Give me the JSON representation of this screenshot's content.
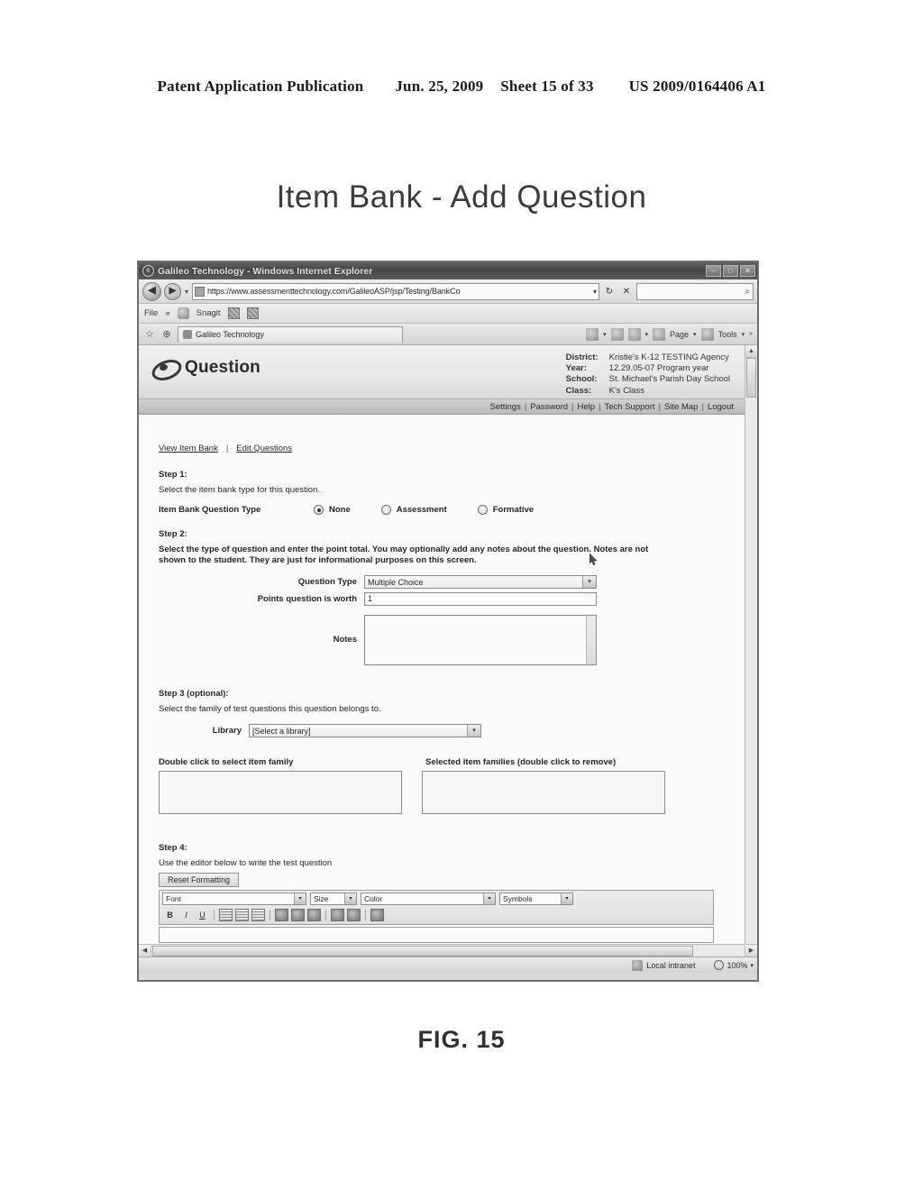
{
  "patent": {
    "publication": "Patent Application Publication",
    "date": "Jun. 25, 2009",
    "sheet": "Sheet 15 of 33",
    "number": "US 2009/0164406 A1",
    "figure_caption": "FIG. 15",
    "figure_title": "Item Bank - Add Question"
  },
  "browser": {
    "window_title": "Galileo Technology - Windows Internet Explorer",
    "window_icon": "e",
    "minimize_label": "–",
    "maximize_label": "□",
    "close_label": "✕",
    "back_label": "◀",
    "forward_label": "▶",
    "history_caret": "▾",
    "url": "https://www.assessmenttechnology.com/GalileoASP/jsp/Testing/BankCo",
    "url_dropdown": "▾",
    "refresh_label": "↻",
    "stop_label": "✕",
    "search_placeholder": "",
    "search_go": "⌕",
    "menu": {
      "file": "File",
      "more": "»"
    },
    "snagit": {
      "label": "Snagit",
      "icon1": "snagit-capture-icon",
      "icon2": "snagit-grid-icon"
    },
    "favorites_icon": "☆",
    "addtabs_icon": "⊕",
    "tab_title": "Galileo Technology",
    "toolbar_right": {
      "home": "home-icon",
      "home_caret": "▾",
      "feeds": "rss-icon",
      "print": "printer-icon",
      "print_caret": "▾",
      "page_label": "Page",
      "page_caret": "▾",
      "tools_label": "Tools",
      "tools_caret": "▾",
      "chevron": "»"
    },
    "status": {
      "zone": "Local intranet",
      "zoom": "100%",
      "zoom_caret": "▾"
    },
    "scroll": {
      "up": "▲",
      "down": "▼",
      "left": "◀",
      "right": "▶"
    }
  },
  "site": {
    "brand": "Question",
    "context": [
      {
        "label": "District:",
        "value": "Kristie's K-12 TESTING Agency"
      },
      {
        "label": "Year:",
        "value": "12.29.05-07 Program year"
      },
      {
        "label": "School:",
        "value": "St. Michael's Parish Day School"
      },
      {
        "label": "Class:",
        "value": "K's Class"
      }
    ],
    "nav_links": [
      "Settings",
      "Password",
      "Help",
      "Tech Support",
      "Site Map",
      "Logout"
    ],
    "nav_separator": "|"
  },
  "page": {
    "sublinks": [
      "View Item Bank",
      "Edit Questions"
    ],
    "sublink_separator": "|",
    "step1": {
      "title": "Step 1:",
      "description": "Select the item bank type for this question.",
      "field_label": "Item Bank Question Type",
      "options": [
        {
          "label": "None",
          "checked": true
        },
        {
          "label": "Assessment",
          "checked": false
        },
        {
          "label": "Formative",
          "checked": false
        }
      ]
    },
    "step2": {
      "title": "Step 2:",
      "description": "Select the type of question and enter the point total. You may optionally add any notes about the question. Notes are not shown to the student. They are just for informational purposes on this screen.",
      "question_type_label": "Question Type",
      "question_type_value": "Multiple Choice",
      "points_label": "Points question is worth",
      "points_value": "1",
      "notes_label": "Notes",
      "notes_value": ""
    },
    "step3": {
      "title": "Step 3 (optional):",
      "description": "Select the family of test questions this question belongs to.",
      "library_label": "Library",
      "library_value": "[Select a library]",
      "available_header": "Double click to select item family",
      "selected_header": "Selected item families (double click to remove)",
      "available_items": [],
      "selected_items": []
    },
    "step4": {
      "title": "Step 4:",
      "description": "Use the editor below to write the test question",
      "reset_button": "Reset Formatting",
      "editor": {
        "font_value": "Font",
        "size_value": "Size",
        "color_value": "Color",
        "symbols_value": "Symbols",
        "dropdown_caret": "▾",
        "buttons": [
          {
            "name": "bold-button",
            "label": "B"
          },
          {
            "name": "italic-button",
            "label": "I"
          },
          {
            "name": "underline-button",
            "label": "U"
          },
          {
            "name": "align-left-button",
            "label": ""
          },
          {
            "name": "align-center-button",
            "label": ""
          },
          {
            "name": "align-right-button",
            "label": ""
          },
          {
            "name": "cut-button",
            "label": ""
          },
          {
            "name": "copy-button",
            "label": ""
          },
          {
            "name": "paste-button",
            "label": ""
          },
          {
            "name": "outdent-button",
            "label": ""
          },
          {
            "name": "indent-button",
            "label": ""
          },
          {
            "name": "superscript-button",
            "label": ""
          }
        ],
        "content": ""
      }
    }
  }
}
